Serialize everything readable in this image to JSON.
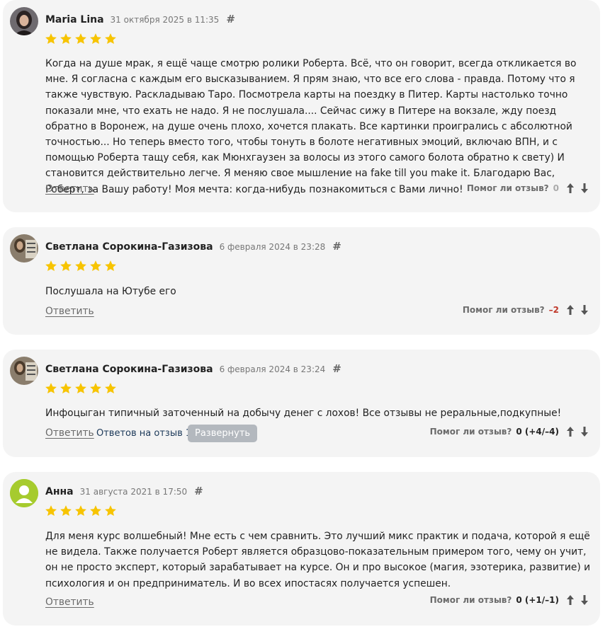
{
  "colors": {
    "star": "#f7c400",
    "card_bg": "#f4f4f4",
    "negative": "#c0392b",
    "avatar_green": "#a6cb2e"
  },
  "reviews": [
    {
      "author": "Maria Lina",
      "date": "31 октября 2025 в 11:35",
      "hash": "#",
      "rating": 5,
      "text": "Когда на душе мрак, я ещё чаще смотрю ролики Роберта. Всё, что он говорит, всегда откликается во мне. Я согласна с каждым его высказыванием. Я прям знаю, что все его слова - правда. Потому что я также чувствую. Раскладываю Таро. Посмотрела карты на поездку в Питер. Карты настолько точно показали мне, что ехать не надо. Я не послушала.... Сейчас сижу в Питере на вокзале, жду поезд обратно в Воронеж, на душе очень плохо, хочется плакать. Все картинки проигрались с абсолютной точностью... Но теперь вместо того, чтобы тонуть в болоте негативных эмоций, включаю ВПН, и с помощью Роберта тащу себя, как Мюнхгаузен за волосы из этого самого болота обратно к свету) И становится действительно легче. Я меняю свое мышление на fake till you make it. Благодарю Вас, Роберт, за Вашу работу! Моя мечта: когда-нибудь познакомиться с Вами лично!",
      "reply_label": "Ответить",
      "helpful_label": "Помог ли отзыв?",
      "score": "0"
    },
    {
      "author": "Светлана Сорокина-Газизова",
      "date": "6 февраля 2024 в 23:28",
      "hash": "#",
      "rating": 5,
      "text": "Послушала на Ютубе его",
      "reply_label": "Ответить",
      "helpful_label": "Помог ли отзыв?",
      "score": "–2"
    },
    {
      "author": "Светлана Сорокина-Газизова",
      "date": "6 февраля 2024 в 23:24",
      "hash": "#",
      "rating": 5,
      "text": "Инфоцыган типичный заточенный на добычу денег с лохов! Все отзывы не реральные,подкупные!",
      "reply_label": "Ответить",
      "replies_label": "Ответов на отзыв 1",
      "expand_label": "Развернуть",
      "helpful_label": "Помог ли отзыв?",
      "score": "0 (+4/–4)"
    },
    {
      "author": "Анна",
      "date": "31 августа 2021 в 17:50",
      "hash": "#",
      "rating": 5,
      "text": "Для меня курс волшебный! Мне есть с чем сравнить. Это лучший микс практик и подача, которой я ещё не видела. Также получается Роберт является образцово-показательным примером того, чему он учит, он не просто эксперт, который зарабатывает на курсе. Он и про высокое (магия, эзотерика, развитие) и психология и он предприниматель. И во всех ипостасях получается успешен.",
      "reply_label": "Ответить",
      "helpful_label": "Помог ли отзыв?",
      "score": "0 (+1/–1)"
    }
  ]
}
